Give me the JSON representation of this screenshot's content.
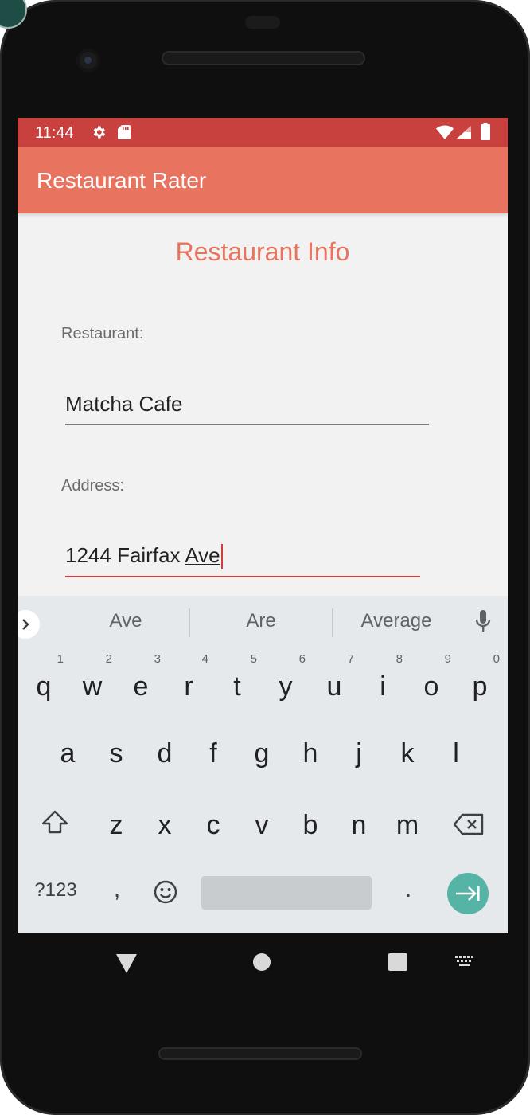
{
  "status_bar": {
    "time": "11:44",
    "icons": [
      "gear-icon",
      "sd-card-icon",
      "wifi-icon",
      "signal-icon",
      "battery-icon"
    ]
  },
  "app_bar": {
    "title": "Restaurant Rater",
    "color": "#e8735f"
  },
  "form": {
    "section_title": "Restaurant Info",
    "restaurant_label": "Restaurant:",
    "restaurant_value": "Matcha Cafe",
    "address_label": "Address:",
    "address_value_prefix": "1244 Fairfax ",
    "address_value_composing": "Ave"
  },
  "keyboard": {
    "suggestions": [
      "Ave",
      "Are",
      "Average"
    ],
    "row1": [
      {
        "key": "q",
        "hint": "1"
      },
      {
        "key": "w",
        "hint": "2"
      },
      {
        "key": "e",
        "hint": "3"
      },
      {
        "key": "r",
        "hint": "4"
      },
      {
        "key": "t",
        "hint": "5"
      },
      {
        "key": "y",
        "hint": "6"
      },
      {
        "key": "u",
        "hint": "7"
      },
      {
        "key": "i",
        "hint": "8"
      },
      {
        "key": "o",
        "hint": "9"
      },
      {
        "key": "p",
        "hint": "0"
      }
    ],
    "row2": [
      "a",
      "s",
      "d",
      "f",
      "g",
      "h",
      "j",
      "k",
      "l"
    ],
    "row3": [
      "z",
      "x",
      "c",
      "v",
      "b",
      "n",
      "m"
    ],
    "symbols_label": "?123",
    "comma": ",",
    "period": ".",
    "enter_color": "#55b4a6"
  },
  "colors": {
    "status_bar": "#c8413f",
    "accent": "#e8735f",
    "screen_bg": "#f2f2f2"
  }
}
